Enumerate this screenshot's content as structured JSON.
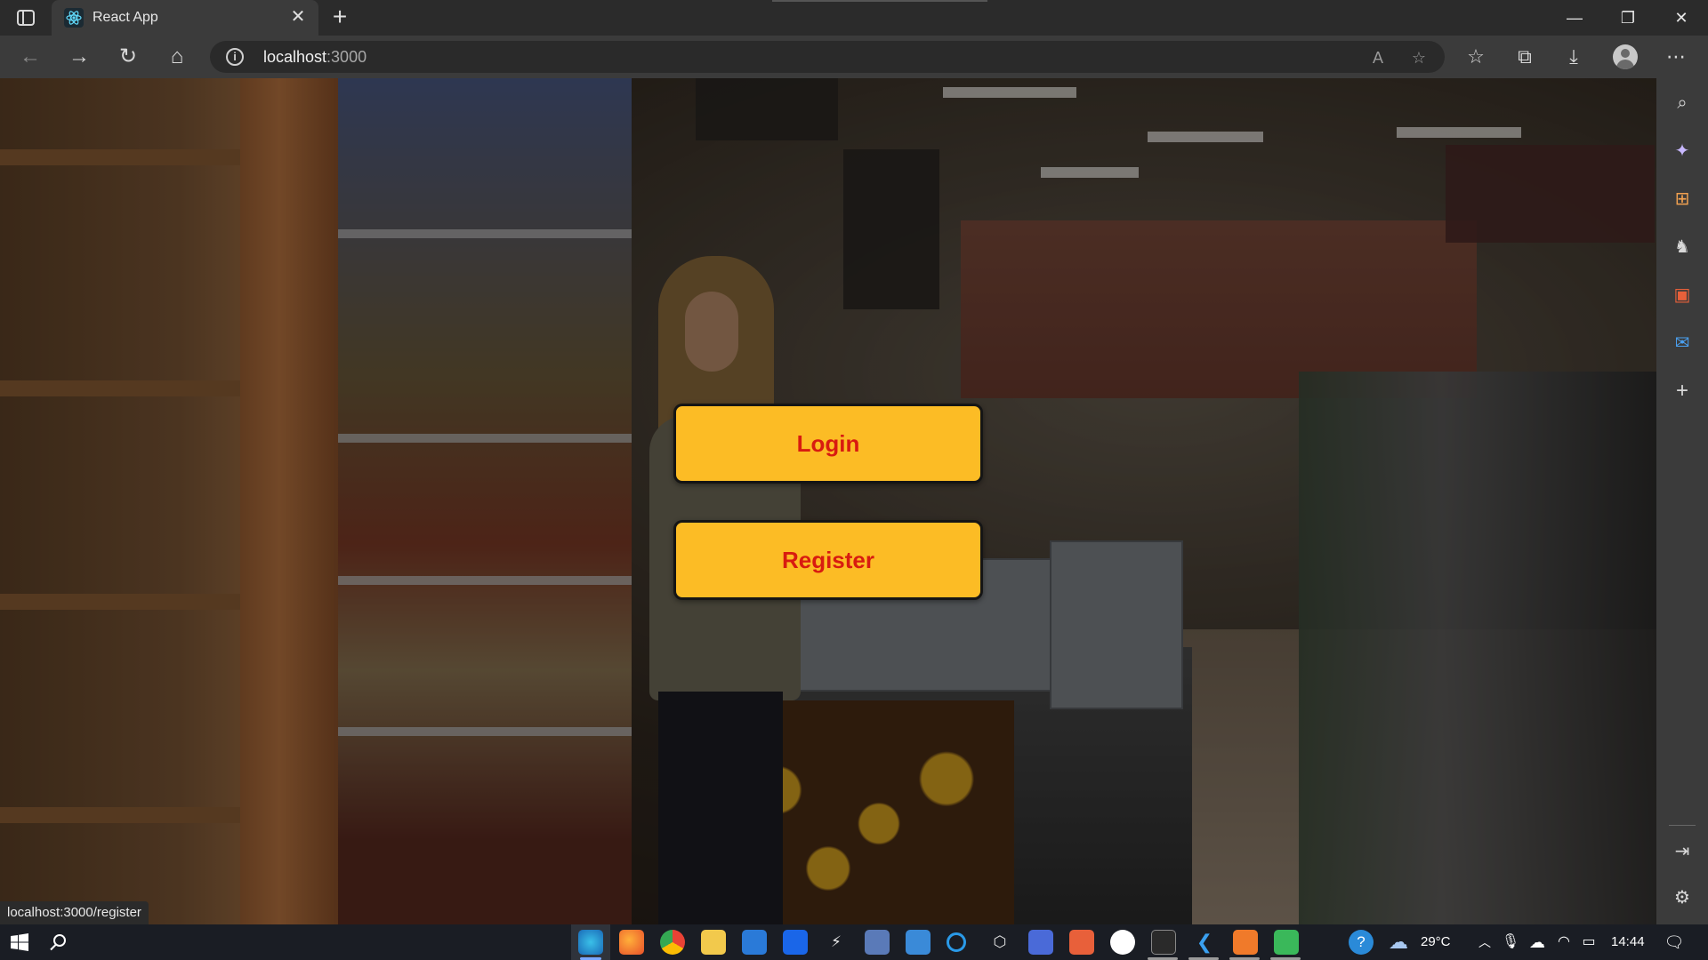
{
  "browser": {
    "tab_title": "React App",
    "tab_close": "✕",
    "new_tab": "+",
    "url_host": "localhost",
    "url_port": ":3000",
    "window_controls": {
      "minimize": "—",
      "restore": "❐",
      "close": "✕"
    }
  },
  "toolbar": {
    "back": "←",
    "forward": "→",
    "refresh": "↻",
    "home": "⌂",
    "info": "i",
    "read_aloud": "A",
    "add_favorite": "☆",
    "favorites": "☆",
    "collections": "⧉",
    "downloads": "⤓",
    "more": "⋯"
  },
  "page": {
    "login_label": "Login",
    "register_label": "Register",
    "colors": {
      "button_bg": "#fcbc25",
      "button_text": "#d81b10",
      "button_border": "#151515"
    }
  },
  "status_bar": {
    "link_preview": "localhost:3000/register"
  },
  "sidebar": {
    "search": "⌕",
    "copilot": "✦",
    "shopping": "⊞",
    "games": "♞",
    "office": "▣",
    "outlook": "✉",
    "add": "+",
    "hide": "⇥",
    "settings": "⚙"
  },
  "taskbar": {
    "temperature": "29°C",
    "time": "14:44"
  }
}
